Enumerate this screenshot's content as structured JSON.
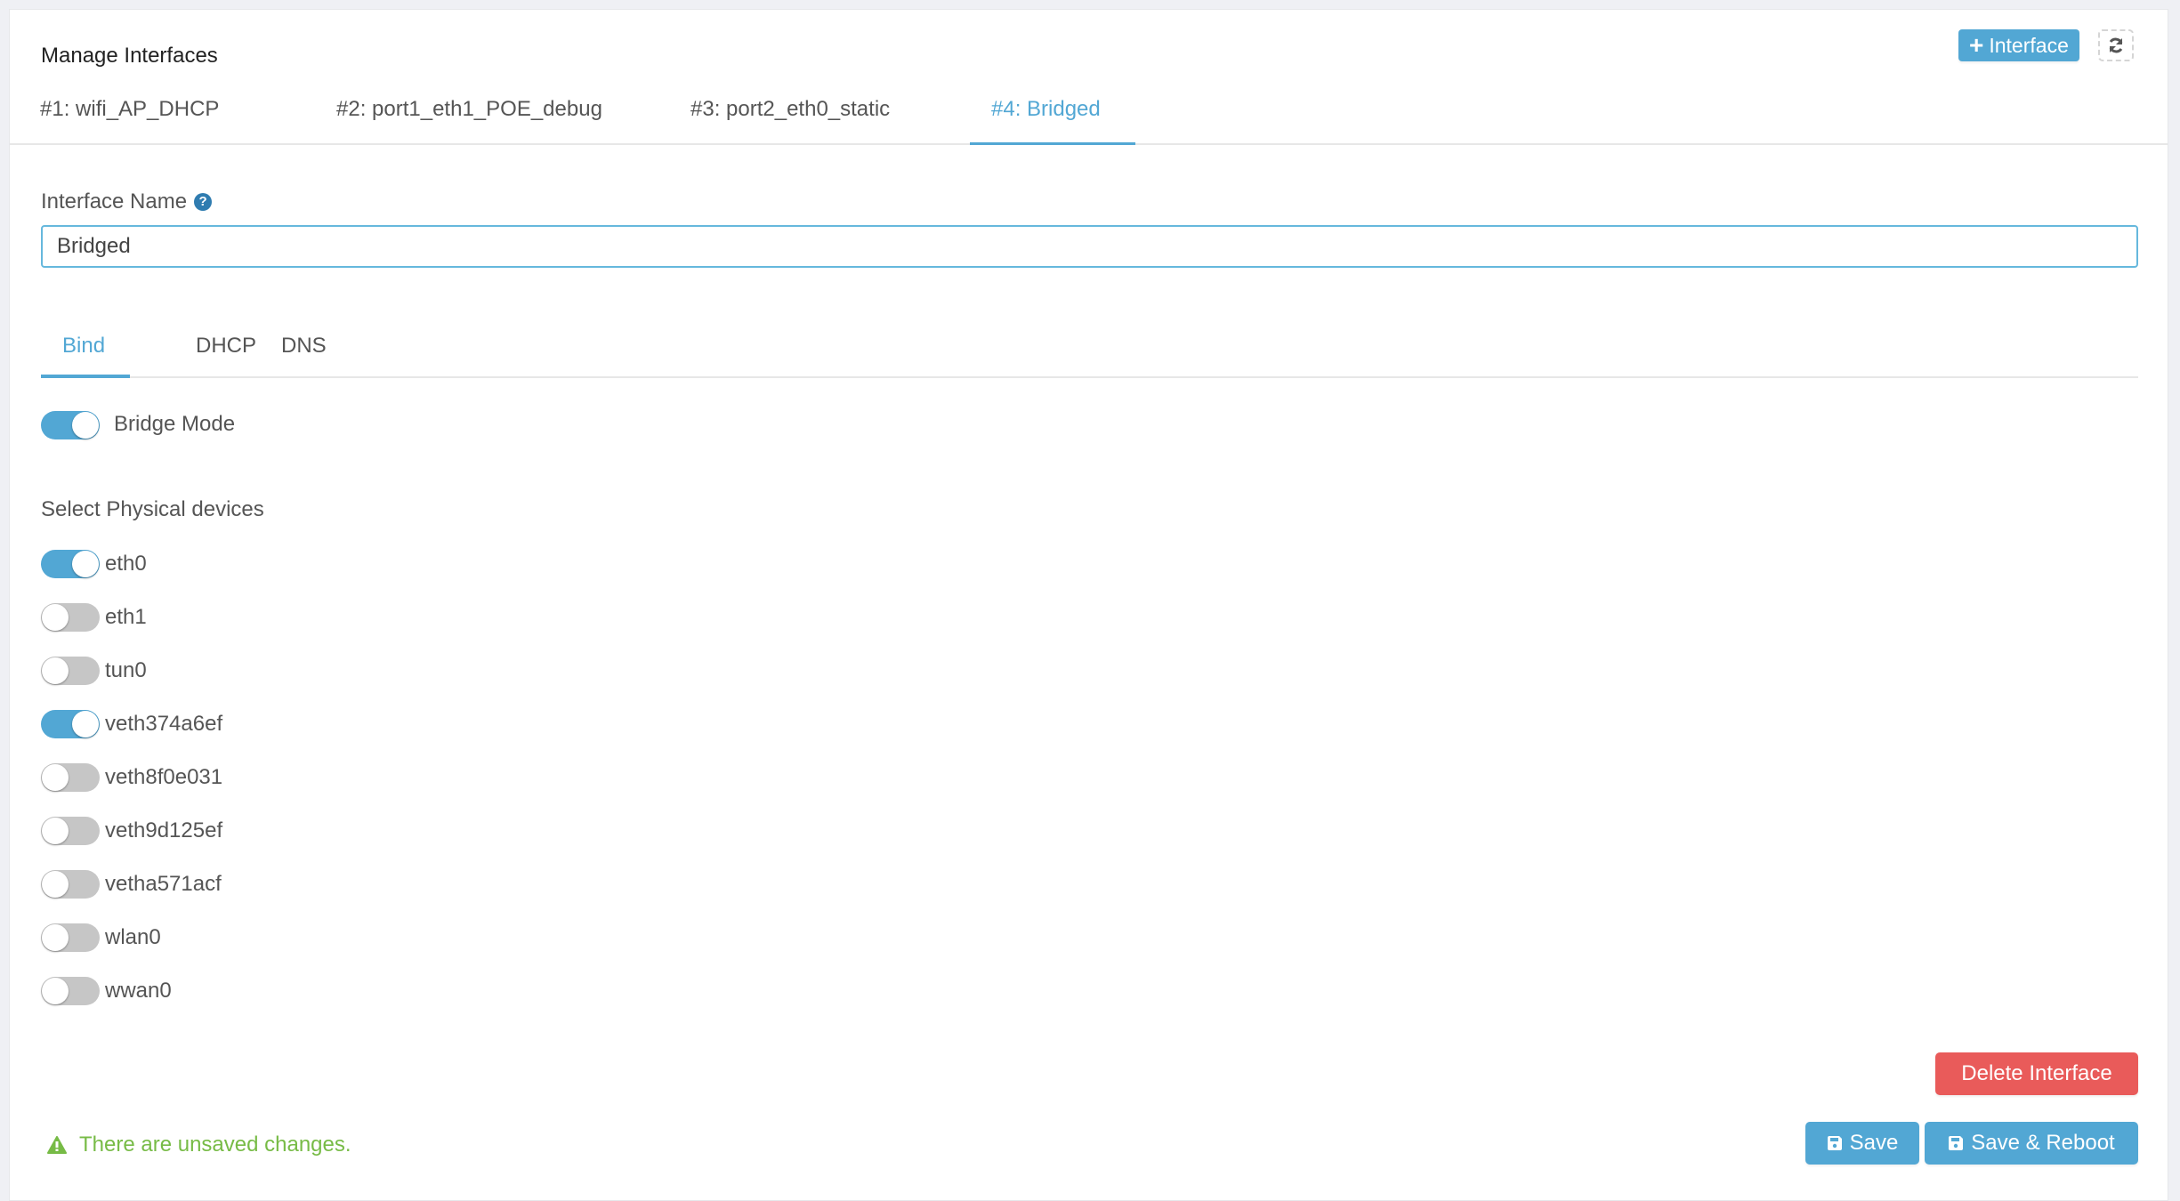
{
  "header": {
    "title": "Manage Interfaces",
    "add_interface_label": "Interface",
    "add_icon": "plus-icon",
    "refresh_icon": "refresh-icon"
  },
  "interface_tabs": [
    {
      "label": "#1: wifi_AP_DHCP",
      "active": false
    },
    {
      "label": "#2: port1_eth1_POE_debug",
      "active": false
    },
    {
      "label": "#3: port2_eth0_static",
      "active": false
    },
    {
      "label": "#4: Bridged",
      "active": true
    }
  ],
  "form": {
    "interface_name_label": "Interface Name",
    "help_icon": "question-circle-icon",
    "interface_name_value": "Bridged"
  },
  "config_tabs": [
    {
      "label": "Bind",
      "active": true
    },
    {
      "label": "DHCP",
      "active": false
    },
    {
      "label": "DNS",
      "active": false
    }
  ],
  "bind": {
    "bridge_mode_label": "Bridge Mode",
    "bridge_mode_on": true,
    "select_devices_label": "Select Physical devices",
    "devices": [
      {
        "name": "eth0",
        "on": true
      },
      {
        "name": "eth1",
        "on": false
      },
      {
        "name": "tun0",
        "on": false
      },
      {
        "name": "veth374a6ef",
        "on": true
      },
      {
        "name": "veth8f0e031",
        "on": false
      },
      {
        "name": "veth9d125ef",
        "on": false
      },
      {
        "name": "vetha571acf",
        "on": false
      },
      {
        "name": "wlan0",
        "on": false
      },
      {
        "name": "wwan0",
        "on": false
      }
    ]
  },
  "footer": {
    "unsaved_message": "There are unsaved changes.",
    "warning_icon": "warning-triangle-icon",
    "delete_label": "Delete Interface",
    "save_label": "Save",
    "save_reboot_label": "Save & Reboot",
    "save_icon": "floppy-disk-icon"
  },
  "colors": {
    "accent": "#52a7d4",
    "danger": "#e95b5a",
    "success": "#77bb46",
    "toggle_off": "#c6c6c6"
  }
}
